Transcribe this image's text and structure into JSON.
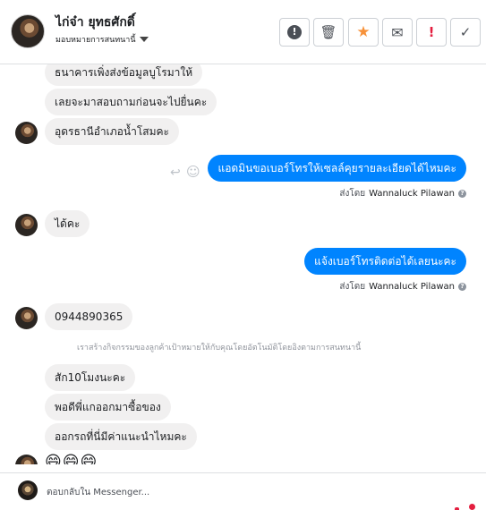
{
  "header": {
    "contact_name": "ไก่จ๋า ยุทธศักดิ์",
    "assign_label": "มอบหมายการสนทนานี้",
    "buttons": [
      {
        "name": "mark-spam-button",
        "glyph": "!"
      },
      {
        "name": "delete-button",
        "glyph": "🗑"
      },
      {
        "name": "star-button",
        "glyph": "★"
      },
      {
        "name": "mark-unread-button",
        "glyph": "✉"
      },
      {
        "name": "priority-button",
        "glyph": "!"
      },
      {
        "name": "done-button",
        "glyph": "✓"
      }
    ]
  },
  "messages": [
    {
      "dir": "in",
      "text": "ธนาคารเพิ่งส่งข้อมูลบูโรมาให้"
    },
    {
      "dir": "in",
      "text": "เลยจะมาสอบถามก่อนจะไปยื่นคะ"
    },
    {
      "dir": "in",
      "text": "อุดรธานีอำเภอน้ำโสมคะ"
    },
    {
      "dir": "out",
      "text": "แอดมินขอเบอร์โทรให้เซลล์คุยรายละเอียดได้ไหมคะ"
    },
    {
      "dir": "in",
      "text": "ได้คะ"
    },
    {
      "dir": "out",
      "text": "แจ้งเบอร์โทรติดต่อได้เลยนะคะ"
    },
    {
      "dir": "in",
      "text": "0944890365"
    },
    {
      "dir": "in",
      "text": "สัก10โมงนะคะ"
    },
    {
      "dir": "in",
      "text": "พอดีพี่แกออกมาซื้อของ"
    },
    {
      "dir": "in",
      "text": "ออกรถที่นี่มีค่าแนะนำไหมคะ"
    }
  ],
  "sent_by": {
    "prefix": "ส่งโดย",
    "name": "Wannaluck Pilawan",
    "info_glyph": "?"
  },
  "notice": "เราสร้างกิจกรรมของลูกค้าเป้าหมายให้กับคุณโดยอัตโนมัติโดยอิงตามการสนทนานี้",
  "emoji_row": "😄😄😄",
  "composer": {
    "placeholder": "ตอบกลับใน Messenger..."
  },
  "colors": {
    "outgoing": "#0084ff",
    "incoming": "#f1f0f0",
    "accent_star": "#f7923a",
    "priority": "#e41e3f"
  }
}
